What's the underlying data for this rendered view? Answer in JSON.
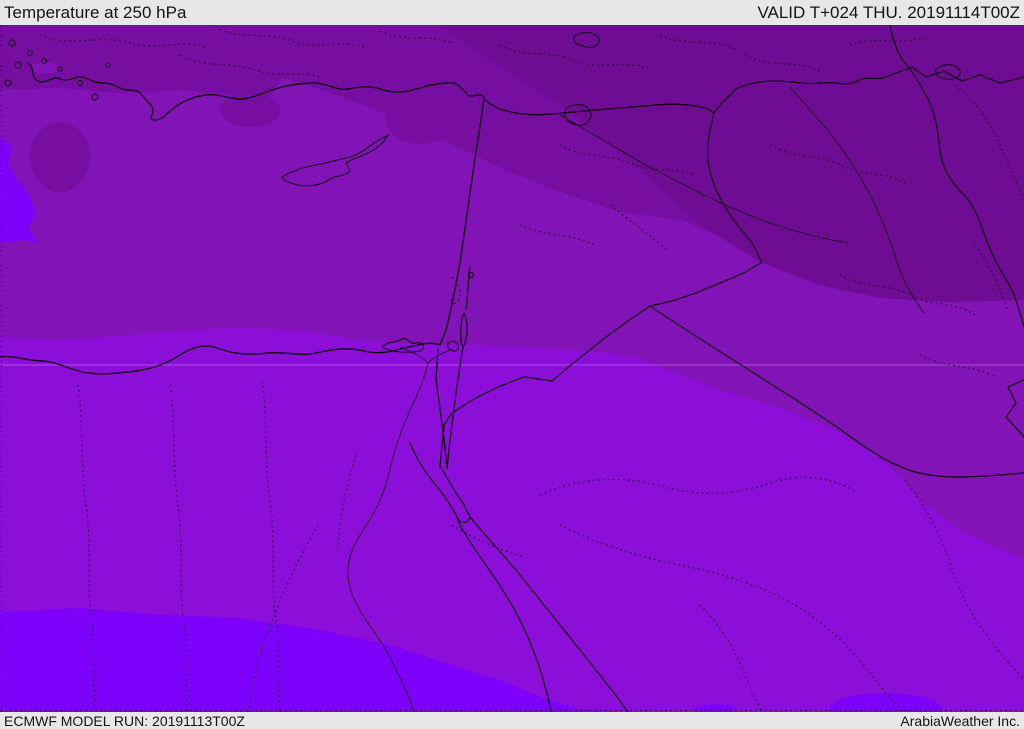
{
  "header": {
    "title": "Temperature at 250 hPa",
    "valid": "VALID T+024 THU. 20191114T00Z"
  },
  "footer": {
    "model_run": "ECMWF MODEL RUN: 20191113T00Z",
    "brand": "ArabiaWeather Inc."
  },
  "map": {
    "colors": {
      "band_darkest": "#6e0c94",
      "band_dark": "#770ea2",
      "band_medium": "#8213b6",
      "band_bright": "#8b0ed9",
      "band_violet": "#7d00fb"
    }
  }
}
